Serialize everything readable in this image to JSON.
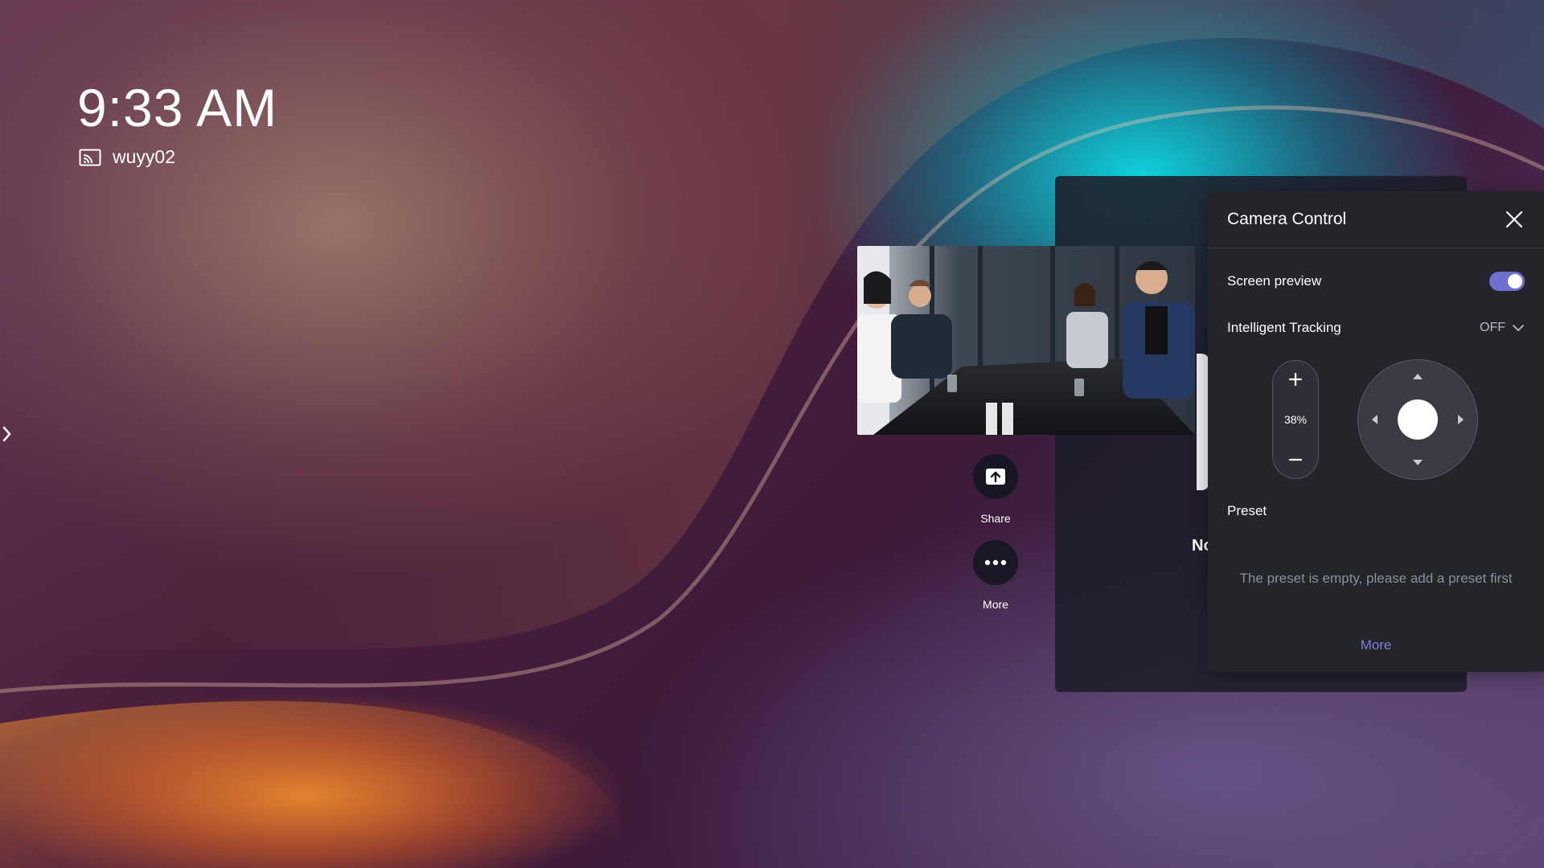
{
  "status": {
    "time": "9:33 AM",
    "device_name": "wuyy02"
  },
  "preview": {
    "background_text": "No"
  },
  "actions": [
    {
      "label": "Share",
      "icon": "share-upload-icon"
    },
    {
      "label": "More",
      "icon": "more-dots-icon"
    }
  ],
  "camera_control": {
    "title": "Camera Control",
    "screen_preview_label": "Screen preview",
    "screen_preview_on": true,
    "tracking_label": "Intelligent Tracking",
    "tracking_value": "OFF",
    "zoom_value": "38%",
    "preset_label": "Preset",
    "preset_empty_text": "The preset is empty, please add a preset first",
    "more_label": "More"
  },
  "colors": {
    "toggle_accent": "#6f6fd2",
    "link": "#7d7fd9",
    "panel_bg": "#24252b"
  }
}
